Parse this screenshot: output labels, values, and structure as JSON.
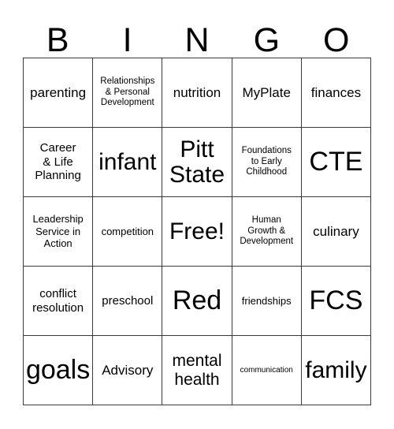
{
  "card": {
    "title": "BINGO",
    "headers": [
      "B",
      "I",
      "N",
      "G",
      "O"
    ],
    "free_space_label": "Free!",
    "grid": [
      [
        {
          "text": "parenting",
          "size": "ml"
        },
        {
          "text": "Relationships\n& Personal\nDevelopment",
          "size": "xs"
        },
        {
          "text": "nutrition",
          "size": "ml"
        },
        {
          "text": "MyPlate",
          "size": "ml"
        },
        {
          "text": "finances",
          "size": "ml"
        }
      ],
      [
        {
          "text": "Career\n& Life\nPlanning",
          "size": "m"
        },
        {
          "text": "infant",
          "size": "xxl"
        },
        {
          "text": "Pitt\nState",
          "size": "xxl"
        },
        {
          "text": "Foundations\nto Early\nChildhood",
          "size": "xs"
        },
        {
          "text": "CTE",
          "size": "3xl"
        }
      ],
      [
        {
          "text": "Leadership\nService in\nAction",
          "size": "s"
        },
        {
          "text": "competition",
          "size": "s"
        },
        {
          "text": "Free!",
          "size": "xxl"
        },
        {
          "text": "Human\nGrowth &\nDevelopment",
          "size": "xs"
        },
        {
          "text": "culinary",
          "size": "ml"
        }
      ],
      [
        {
          "text": "conflict\nresolution",
          "size": "m"
        },
        {
          "text": "preschool",
          "size": "m"
        },
        {
          "text": "Red",
          "size": "3xl"
        },
        {
          "text": "friendships",
          "size": "s"
        },
        {
          "text": "FCS",
          "size": "3xl"
        }
      ],
      [
        {
          "text": "goals",
          "size": "3xl"
        },
        {
          "text": "Advisory",
          "size": "ml"
        },
        {
          "text": "mental\nhealth",
          "size": "l"
        },
        {
          "text": "communication",
          "size": "xxs"
        },
        {
          "text": "family",
          "size": "xxl"
        }
      ]
    ]
  },
  "colors": {
    "background": "#ffffff",
    "text": "#000000",
    "grid_line": "#3a3a3a"
  }
}
